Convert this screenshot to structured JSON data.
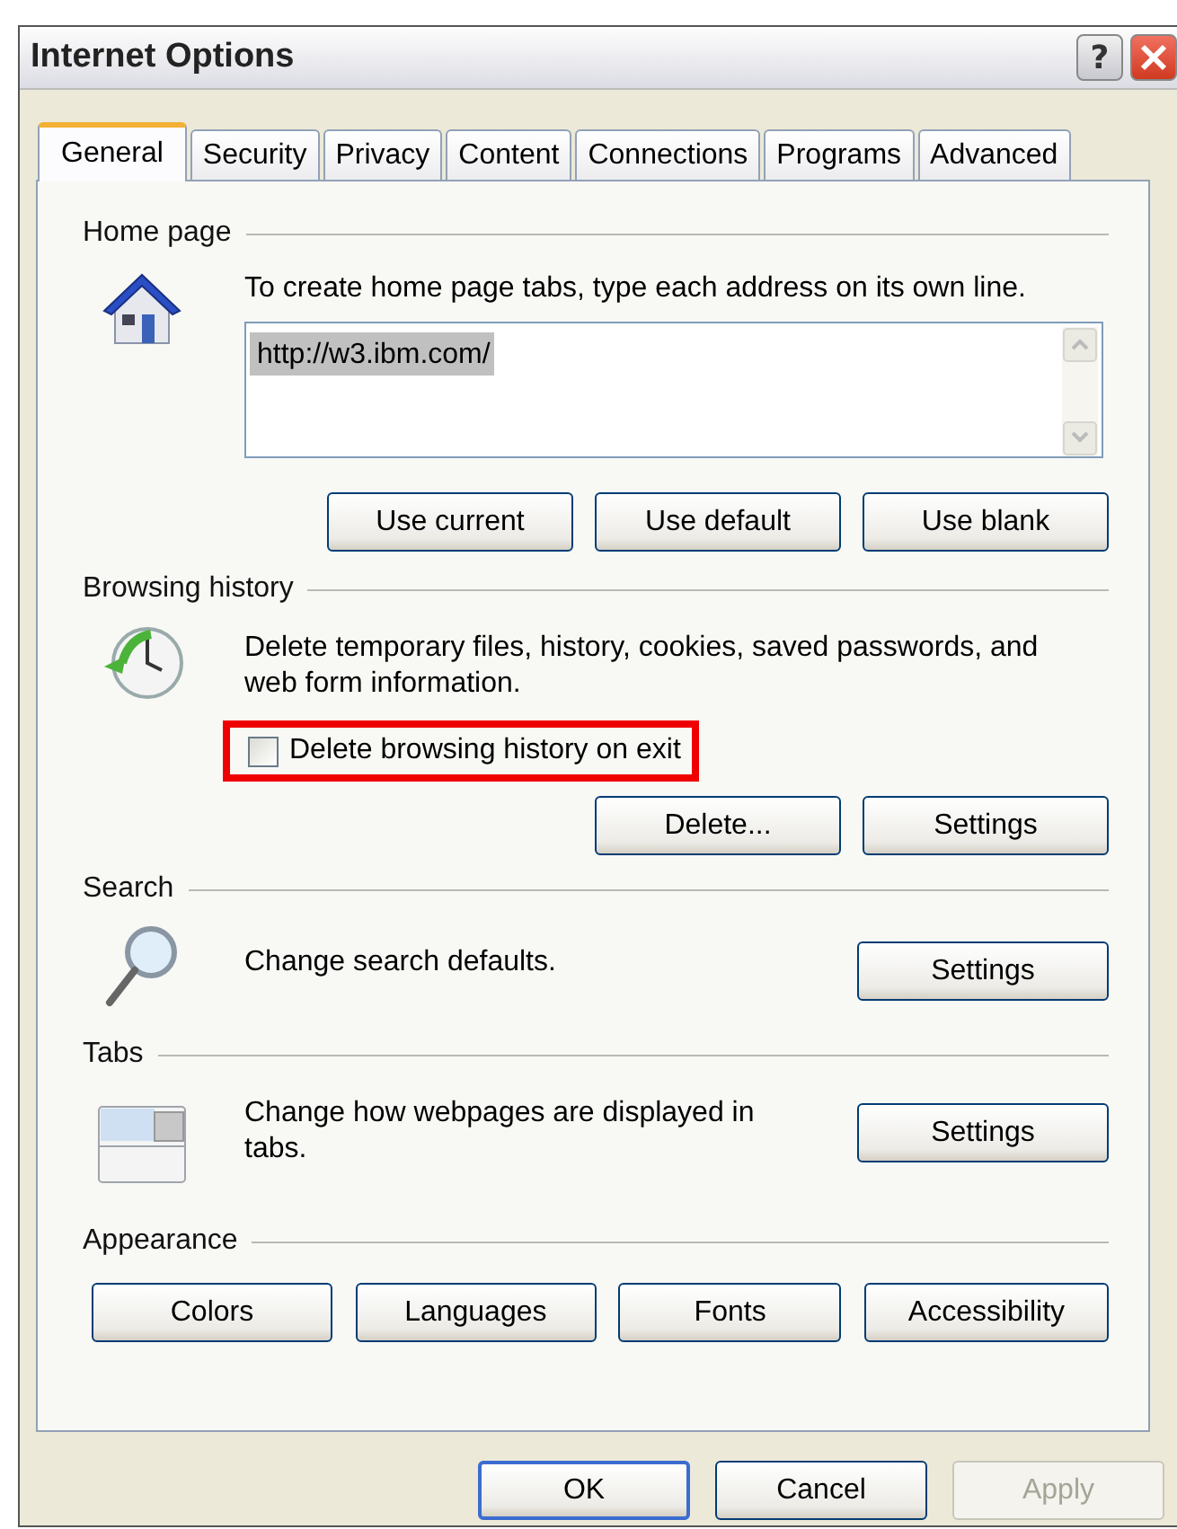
{
  "window": {
    "title": "Internet Options",
    "help_button": "?"
  },
  "tabs": [
    {
      "label": "General",
      "selected": true
    },
    {
      "label": "Security",
      "selected": false
    },
    {
      "label": "Privacy",
      "selected": false
    },
    {
      "label": "Content",
      "selected": false
    },
    {
      "label": "Connections",
      "selected": false
    },
    {
      "label": "Programs",
      "selected": false
    },
    {
      "label": "Advanced",
      "selected": false
    }
  ],
  "home_page": {
    "heading": "Home page",
    "description": "To create home page tabs, type each address on its own line.",
    "value": "http://w3.ibm.com/",
    "value_selected": true,
    "buttons": [
      "Use current",
      "Use default",
      "Use blank"
    ]
  },
  "browsing_history": {
    "heading": "Browsing history",
    "description": "Delete temporary files, history, cookies, saved passwords, and web form information.",
    "checkbox": {
      "label": "Delete browsing history on exit",
      "checked": false,
      "highlighted": true
    },
    "buttons": [
      "Delete...",
      "Settings"
    ]
  },
  "search": {
    "heading": "Search",
    "description": "Change search defaults.",
    "button": "Settings"
  },
  "tabs_section": {
    "heading": "Tabs",
    "description": "Change how webpages are displayed in tabs.",
    "button": "Settings"
  },
  "appearance": {
    "heading": "Appearance",
    "buttons": [
      "Colors",
      "Languages",
      "Fonts",
      "Accessibility"
    ]
  },
  "footer_buttons": [
    {
      "label": "OK",
      "default": true,
      "disabled": false
    },
    {
      "label": "Cancel",
      "default": false,
      "disabled": false
    },
    {
      "label": "Apply",
      "default": false,
      "disabled": true
    }
  ]
}
